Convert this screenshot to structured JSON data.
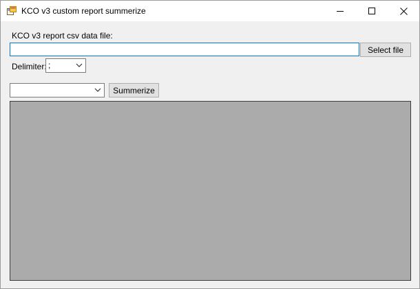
{
  "window": {
    "title": "KCO v3 custom report summerize",
    "controls": {
      "minimize_icon": "minimize-icon",
      "maximize_icon": "maximize-icon",
      "close_icon": "close-icon"
    }
  },
  "file": {
    "label": "KCO v3 report csv data file:",
    "value": "",
    "select_label": "Select file"
  },
  "delimiter": {
    "label": "Delimiter:",
    "value": ";"
  },
  "report": {
    "selected": "",
    "summerize_label": "Summerize"
  },
  "colors": {
    "window_bg": "#f0f0f0",
    "grid_bg": "#ababab",
    "focus_border": "#0078d7"
  }
}
